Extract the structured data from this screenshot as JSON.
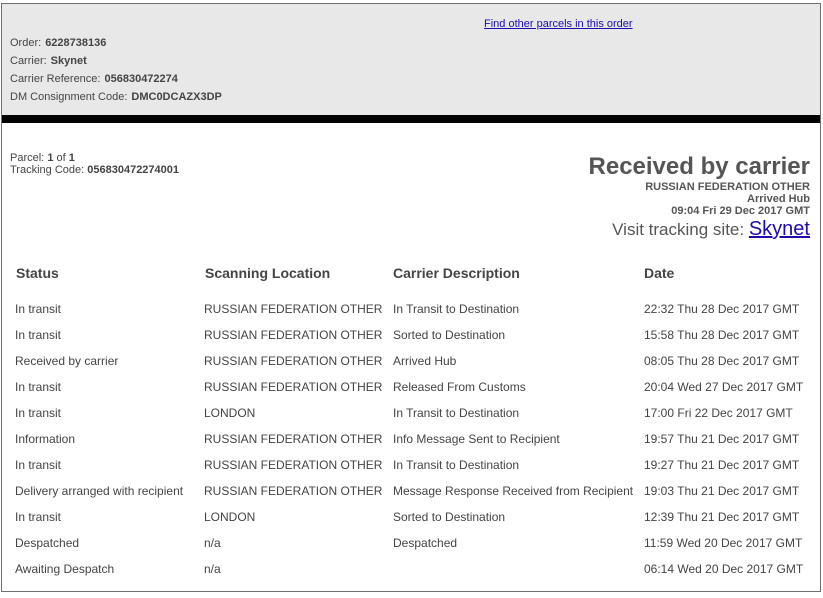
{
  "header": {
    "find_link": "Find other parcels in this order",
    "order_label": "Order:",
    "order_value": "6228738136",
    "carrier_label": "Carrier:",
    "carrier_value": "Skynet",
    "carrier_ref_label": "Carrier Reference:",
    "carrier_ref_value": "056830472274",
    "dm_label": "DM Consignment Code:",
    "dm_value": "DMC0DCAZX3DP"
  },
  "parcel": {
    "parcel_label": "Parcel:",
    "parcel_num": "1",
    "of_text": "of",
    "parcel_total": "1",
    "tracking_label": "Tracking Code:",
    "tracking_value": "056830472274001"
  },
  "current": {
    "status": "Received by carrier",
    "location": "RUSSIAN FEDERATION OTHER",
    "description": "Arrived Hub",
    "datetime": "09:04 Fri 29 Dec 2017 GMT",
    "visit_label": "Visit tracking site:",
    "visit_link": "Skynet"
  },
  "table": {
    "headers": [
      "Status",
      "Scanning Location",
      "Carrier Description",
      "Date"
    ],
    "rows": [
      [
        "In transit",
        "RUSSIAN FEDERATION OTHER",
        "In Transit to Destination",
        "22:32 Thu 28 Dec 2017 GMT"
      ],
      [
        "In transit",
        "RUSSIAN FEDERATION OTHER",
        "Sorted to Destination",
        "15:58 Thu 28 Dec 2017 GMT"
      ],
      [
        "Received by carrier",
        "RUSSIAN FEDERATION OTHER",
        "Arrived Hub",
        "08:05 Thu 28 Dec 2017 GMT"
      ],
      [
        "In transit",
        "RUSSIAN FEDERATION OTHER",
        "Released From Customs",
        "20:04 Wed 27 Dec 2017 GMT"
      ],
      [
        "In transit",
        "LONDON",
        "In Transit to Destination",
        "17:00 Fri 22 Dec 2017 GMT"
      ],
      [
        "Information",
        "RUSSIAN FEDERATION OTHER",
        "Info Message Sent to Recipient",
        "19:57 Thu 21 Dec 2017 GMT"
      ],
      [
        "In transit",
        "RUSSIAN FEDERATION OTHER",
        "In Transit to Destination",
        "19:27 Thu 21 Dec 2017 GMT"
      ],
      [
        "Delivery arranged with recipient",
        "RUSSIAN FEDERATION OTHER",
        "Message Response Received from Recipient",
        "19:03 Thu 21 Dec 2017 GMT"
      ],
      [
        "In transit",
        "LONDON",
        "Sorted to Destination",
        "12:39 Thu 21 Dec 2017 GMT"
      ],
      [
        "Despatched",
        "n/a",
        "Despatched",
        "11:59 Wed 20 Dec 2017 GMT"
      ],
      [
        "Awaiting Despatch",
        "n/a",
        "",
        "06:14 Wed 20 Dec 2017 GMT"
      ]
    ]
  }
}
